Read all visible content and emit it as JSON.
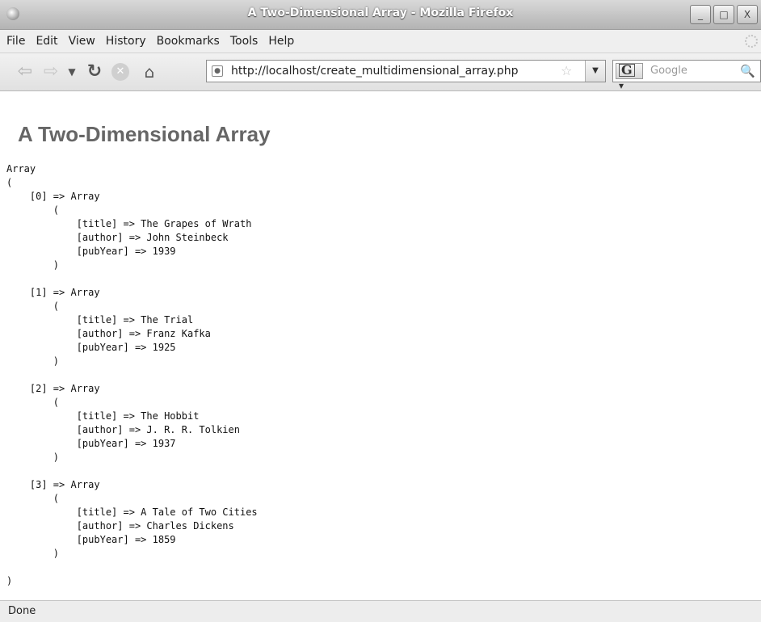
{
  "window": {
    "title": "A Two-Dimensional Array - Mozilla Firefox",
    "controls": {
      "minimize": "_",
      "maximize": "□",
      "close": "X"
    }
  },
  "menu": {
    "items": [
      "File",
      "Edit",
      "View",
      "History",
      "Bookmarks",
      "Tools",
      "Help"
    ]
  },
  "navigation": {
    "url": "http://localhost/create_multidimensional_array.php",
    "search_placeholder": "Google",
    "search_engine_letter": "G",
    "icons": [
      "back-arrow",
      "forward-arrow",
      "dropdown",
      "reload",
      "stop",
      "home",
      "site-identity",
      "bookmark-star",
      "search-magnifier"
    ]
  },
  "page": {
    "heading": "A Two-Dimensional Array",
    "output": "Array\n(\n    [0] => Array\n        (\n            [title] => The Grapes of Wrath\n            [author] => John Steinbeck\n            [pubYear] => 1939\n        )\n\n    [1] => Array\n        (\n            [title] => The Trial\n            [author] => Franz Kafka\n            [pubYear] => 1925\n        )\n\n    [2] => Array\n        (\n            [title] => The Hobbit\n            [author] => J. R. R. Tolkien\n            [pubYear] => 1937\n        )\n\n    [3] => Array\n        (\n            [title] => A Tale of Two Cities\n            [author] => Charles Dickens\n            [pubYear] => 1859\n        )\n\n)"
  },
  "status": {
    "text": "Done"
  }
}
